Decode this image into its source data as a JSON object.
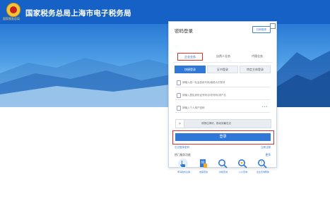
{
  "header": {
    "emblem_caption": "国家税务总局",
    "title": "国家税务总局上海市电子税务局"
  },
  "login": {
    "title": "密码登录",
    "alt_link": "扫码登录",
    "taxpayer_types": [
      "企业业务",
      "自然人业务",
      "代理业务"
    ],
    "login_modes": [
      "快捷登录",
      "证书登录",
      "特定主体登录"
    ],
    "fields": {
      "credit_code_placeholder": "请输入统一社会信用代码/纳税人识别号",
      "id_placeholder": "请输入居民身份证号码/手机号码/用户名",
      "password_placeholder": "请输入个人用户密码"
    },
    "slider_hint": "请按住滑块，拖动到最右边",
    "login_button": "登录",
    "forgot_password": "忘记登录密码",
    "register": "立即注册"
  },
  "services": {
    "heading": "热门服务功能",
    "more": "更多",
    "items": [
      {
        "label": "申请税务注销"
      },
      {
        "label": "发票查验"
      },
      {
        "label": "办税查询"
      },
      {
        "label": "公众查询"
      },
      {
        "label": "企业查询帮助"
      }
    ]
  },
  "colors": {
    "brand_blue": "#1561c5",
    "button_blue": "#2f78d8",
    "highlight_red": "#e0302a"
  }
}
